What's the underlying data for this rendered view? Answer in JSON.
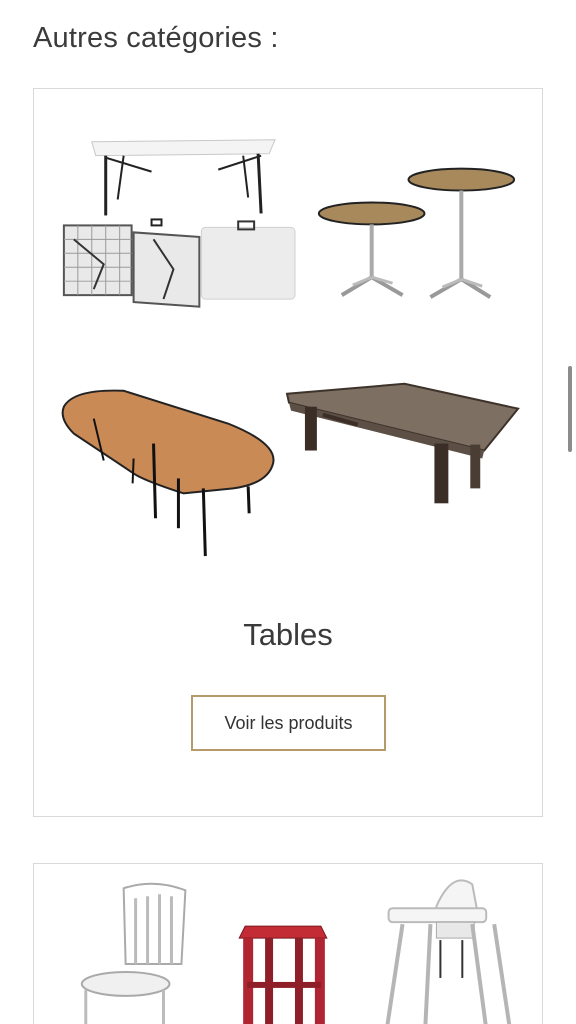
{
  "section": {
    "title": "Autres catégories :"
  },
  "categories": [
    {
      "name": "Tables",
      "button_label": "Voir les produits",
      "image_icon": "tables-image-icon"
    },
    {
      "name": "",
      "button_label": "",
      "image_icon": "chairs-image-icon"
    }
  ],
  "colors": {
    "text": "#3a3a3a",
    "card_border": "#d9d9d9",
    "button_border": "#b59a6a",
    "scrollbar": "#8c8c8c"
  }
}
